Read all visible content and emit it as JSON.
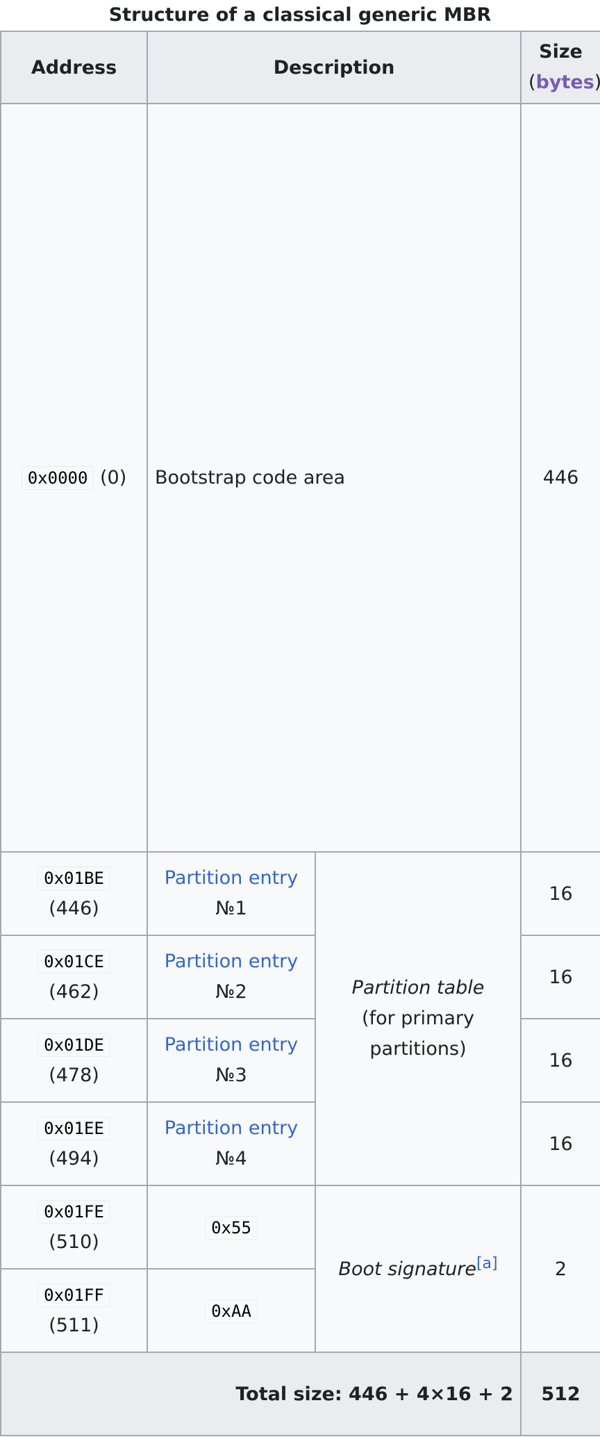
{
  "caption": "Structure of a classical generic MBR",
  "headers": {
    "address": "Address",
    "description": "Description",
    "size_line1": "Size",
    "size_open": "(",
    "size_unit_link": "bytes",
    "size_close": ")"
  },
  "rows": {
    "bootstrap": {
      "address_code": "0x0000",
      "address_dec": "(0)",
      "description": "Bootstrap code area",
      "size": "446"
    },
    "p1": {
      "address_code": "0x01BE",
      "address_dec": "(446)",
      "entry_link": "Partition entry",
      "entry_num": "№1",
      "size": "16"
    },
    "p2": {
      "address_code": "0x01CE",
      "address_dec": "(462)",
      "entry_link": "Partition entry",
      "entry_num": "№2",
      "size": "16"
    },
    "p3": {
      "address_code": "0x01DE",
      "address_dec": "(478)",
      "entry_link": "Partition entry",
      "entry_num": "№3",
      "size": "16"
    },
    "p4": {
      "address_code": "0x01EE",
      "address_dec": "(494)",
      "entry_link": "Partition entry",
      "entry_num": "№4",
      "size": "16"
    },
    "sig1": {
      "address_code": "0x01FE",
      "address_dec": "(510)",
      "value_code": "0x55"
    },
    "sig2": {
      "address_code": "0x01FF",
      "address_dec": "(511)",
      "value_code": "0xAA"
    }
  },
  "partition_table": {
    "title": "Partition table",
    "line2": "(for primary",
    "line3": "partitions)"
  },
  "boot_signature": {
    "label": "Boot signature",
    "footnote": "[a]",
    "size": "2"
  },
  "total": {
    "label": "Total size: 446 + 4×16 + 2",
    "size": "512"
  },
  "colors": {
    "link": "#3366cc",
    "visited_link": "#795cb2",
    "border": "#a2a9b1",
    "header_bg": "#eaecf0",
    "cell_bg": "#f8f9fa"
  }
}
